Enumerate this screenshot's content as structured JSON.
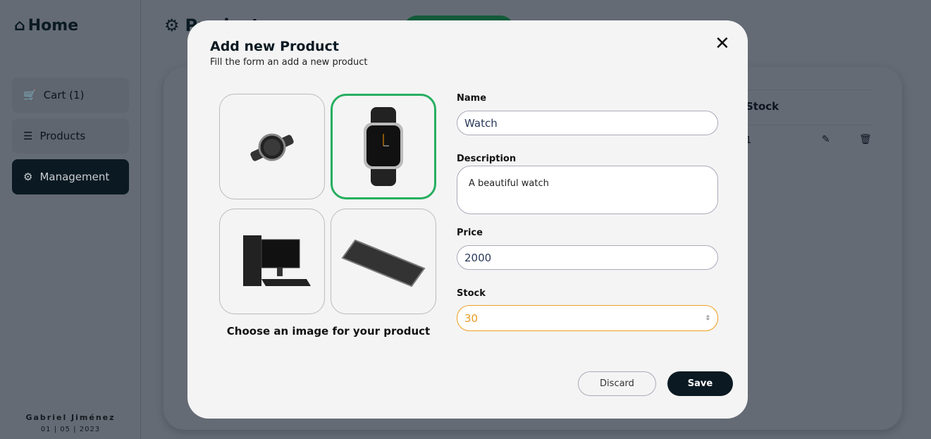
{
  "sidebar": {
    "title": "Home",
    "items": [
      {
        "label": "Cart (1)"
      },
      {
        "label": "Products"
      },
      {
        "label": "Management"
      }
    ],
    "user": "Gabriel Jiménez",
    "date": "01 | 05 | 2023"
  },
  "main": {
    "title": "Products",
    "table_header": "Stock",
    "row_stock": "1"
  },
  "modal": {
    "title": "Add new Product",
    "subtitle": "Fill the form an add a new product",
    "choose_label": "Choose an image for your product",
    "fields": {
      "name_label": "Name",
      "name_value": "Watch",
      "description_label": "Description",
      "description_value": "A beautiful watch",
      "price_label": "Price",
      "price_value": "2000",
      "stock_label": "Stock",
      "stock_value": "30"
    },
    "discard": "Discard",
    "save": "Save"
  },
  "colors": {
    "accent": "#27ae60",
    "dark": "#0b1a22",
    "focus": "#f0a020"
  }
}
